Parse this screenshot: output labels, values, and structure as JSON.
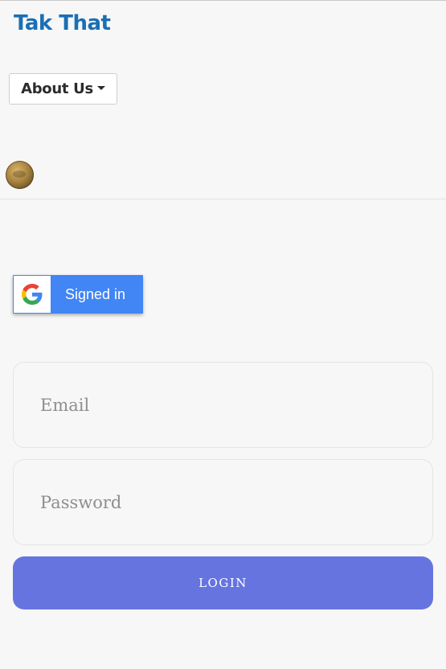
{
  "header": {
    "brand": "Tak That",
    "about_menu_label": "About Us"
  },
  "google_signin": {
    "label": "Signed in",
    "icon": "google-g-icon"
  },
  "login_form": {
    "email_placeholder": "Email",
    "email_value": "",
    "password_placeholder": "Password",
    "password_value": "",
    "login_label": "LOGIN"
  },
  "colors": {
    "brand": "#1a6fb5",
    "google_blue": "#4285f4",
    "login_button": "#6674e0",
    "background": "#f7f7f7"
  }
}
